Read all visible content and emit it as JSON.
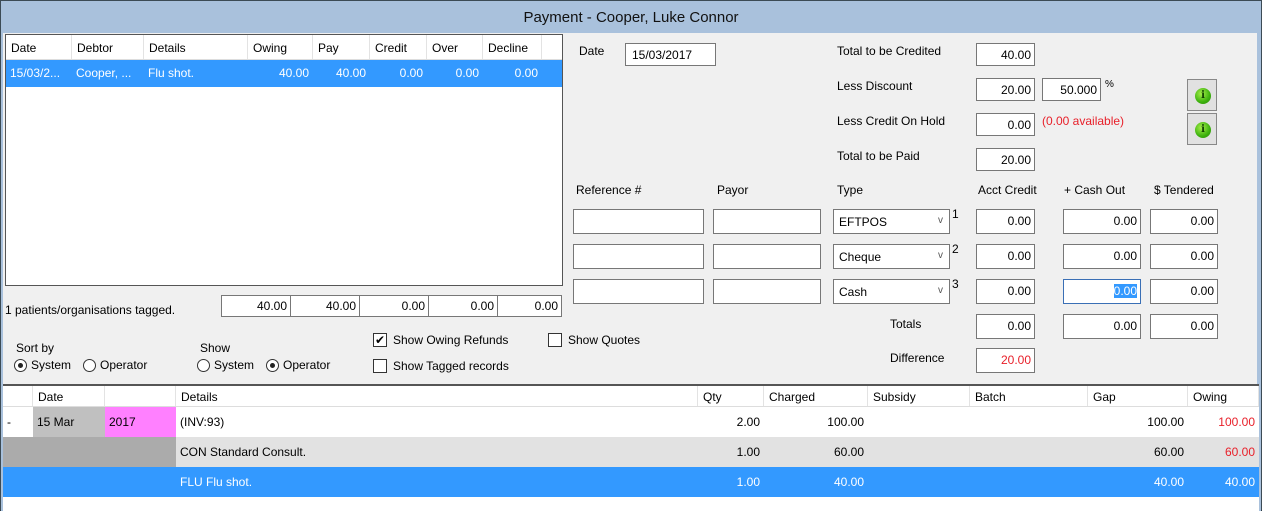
{
  "window": {
    "title": "Payment - Cooper, Luke Connor"
  },
  "debtor_grid": {
    "columns": [
      "Date",
      "Debtor",
      "Details",
      "Owing",
      "Pay",
      "Credit",
      "Over",
      "Decline"
    ],
    "rows": [
      {
        "date": "15/03/2...",
        "debtor": "Cooper, ...",
        "details": "Flu shot.",
        "owing": "40.00",
        "pay": "40.00",
        "credit": "0.00",
        "over": "0.00",
        "decline": "0.00"
      }
    ],
    "tagged_text": "1 patients/organisations tagged.",
    "totals": {
      "owing": "40.00",
      "pay": "40.00",
      "credit": "0.00",
      "over": "0.00",
      "decline": "0.00"
    }
  },
  "sort_by": {
    "label": "Sort by",
    "options": [
      "System",
      "Operator"
    ],
    "selected": "System"
  },
  "show": {
    "label": "Show",
    "options": [
      "System",
      "Operator"
    ],
    "selected": "Operator"
  },
  "checkboxes": {
    "show_owing_refunds": {
      "label": "Show Owing Refunds",
      "checked": true
    },
    "show_tagged_records": {
      "label": "Show Tagged records",
      "checked": false
    },
    "show_quotes": {
      "label": "Show Quotes",
      "checked": false
    }
  },
  "payment": {
    "date_label": "Date",
    "date_value": "15/03/2017",
    "total_credited_label": "Total to be Credited",
    "total_credited": "40.00",
    "less_discount_label": "Less Discount",
    "less_discount": "20.00",
    "discount_percent": "50.000",
    "percent_sign": "%",
    "less_credit_hold_label": "Less Credit On Hold",
    "less_credit_hold": "0.00",
    "available_text": "(0.00 available)",
    "total_paid_label": "Total to be Paid",
    "total_paid": "20.00",
    "columns": {
      "reference": "Reference #",
      "payor": "Payor",
      "type": "Type",
      "acct_credit": "Acct Credit",
      "cash_out": "+ Cash Out",
      "tendered": "$ Tendered"
    },
    "lines": [
      {
        "num": "1",
        "reference": "",
        "payor": "",
        "type": "EFTPOS",
        "acct_credit": "0.00",
        "cash_out": "0.00",
        "tendered": "0.00"
      },
      {
        "num": "2",
        "reference": "",
        "payor": "",
        "type": "Cheque",
        "acct_credit": "0.00",
        "cash_out": "0.00",
        "tendered": "0.00"
      },
      {
        "num": "3",
        "reference": "",
        "payor": "",
        "type": "Cash",
        "acct_credit": "0.00",
        "cash_out": "0.00",
        "tendered": "0.00"
      }
    ],
    "totals_label": "Totals",
    "totals": {
      "acct_credit": "0.00",
      "cash_out": "0.00",
      "tendered": "0.00"
    },
    "difference_label": "Difference",
    "difference": "20.00"
  },
  "icons": {
    "info": "i",
    "chevron": "v",
    "check": "✔"
  },
  "invoice_grid": {
    "columns": [
      "",
      "Date",
      "",
      "Details",
      "Qty",
      "Charged",
      "Subsidy",
      "Batch",
      "Gap",
      "Owing"
    ],
    "rows": [
      {
        "expander": "-",
        "date": "15 Mar",
        "year": "2017",
        "details": "(INV:93)",
        "qty": "2.00",
        "charged": "100.00",
        "subsidy": "",
        "batch": "",
        "gap": "100.00",
        "owing": "100.00"
      },
      {
        "expander": "",
        "date": "",
        "year": "",
        "details": "CON Standard Consult.",
        "qty": "1.00",
        "charged": "60.00",
        "subsidy": "",
        "batch": "",
        "gap": "60.00",
        "owing": "60.00"
      },
      {
        "expander": "",
        "date": "",
        "year": "",
        "details": "FLU Flu shot.",
        "qty": "1.00",
        "charged": "40.00",
        "subsidy": "",
        "batch": "",
        "gap": "40.00",
        "owing": "40.00"
      }
    ]
  },
  "colors": {
    "selection": "#3399ff",
    "negative": "#e8202a",
    "title_bar": "#a9c1dc",
    "year_highlight": "#ff80ff"
  }
}
